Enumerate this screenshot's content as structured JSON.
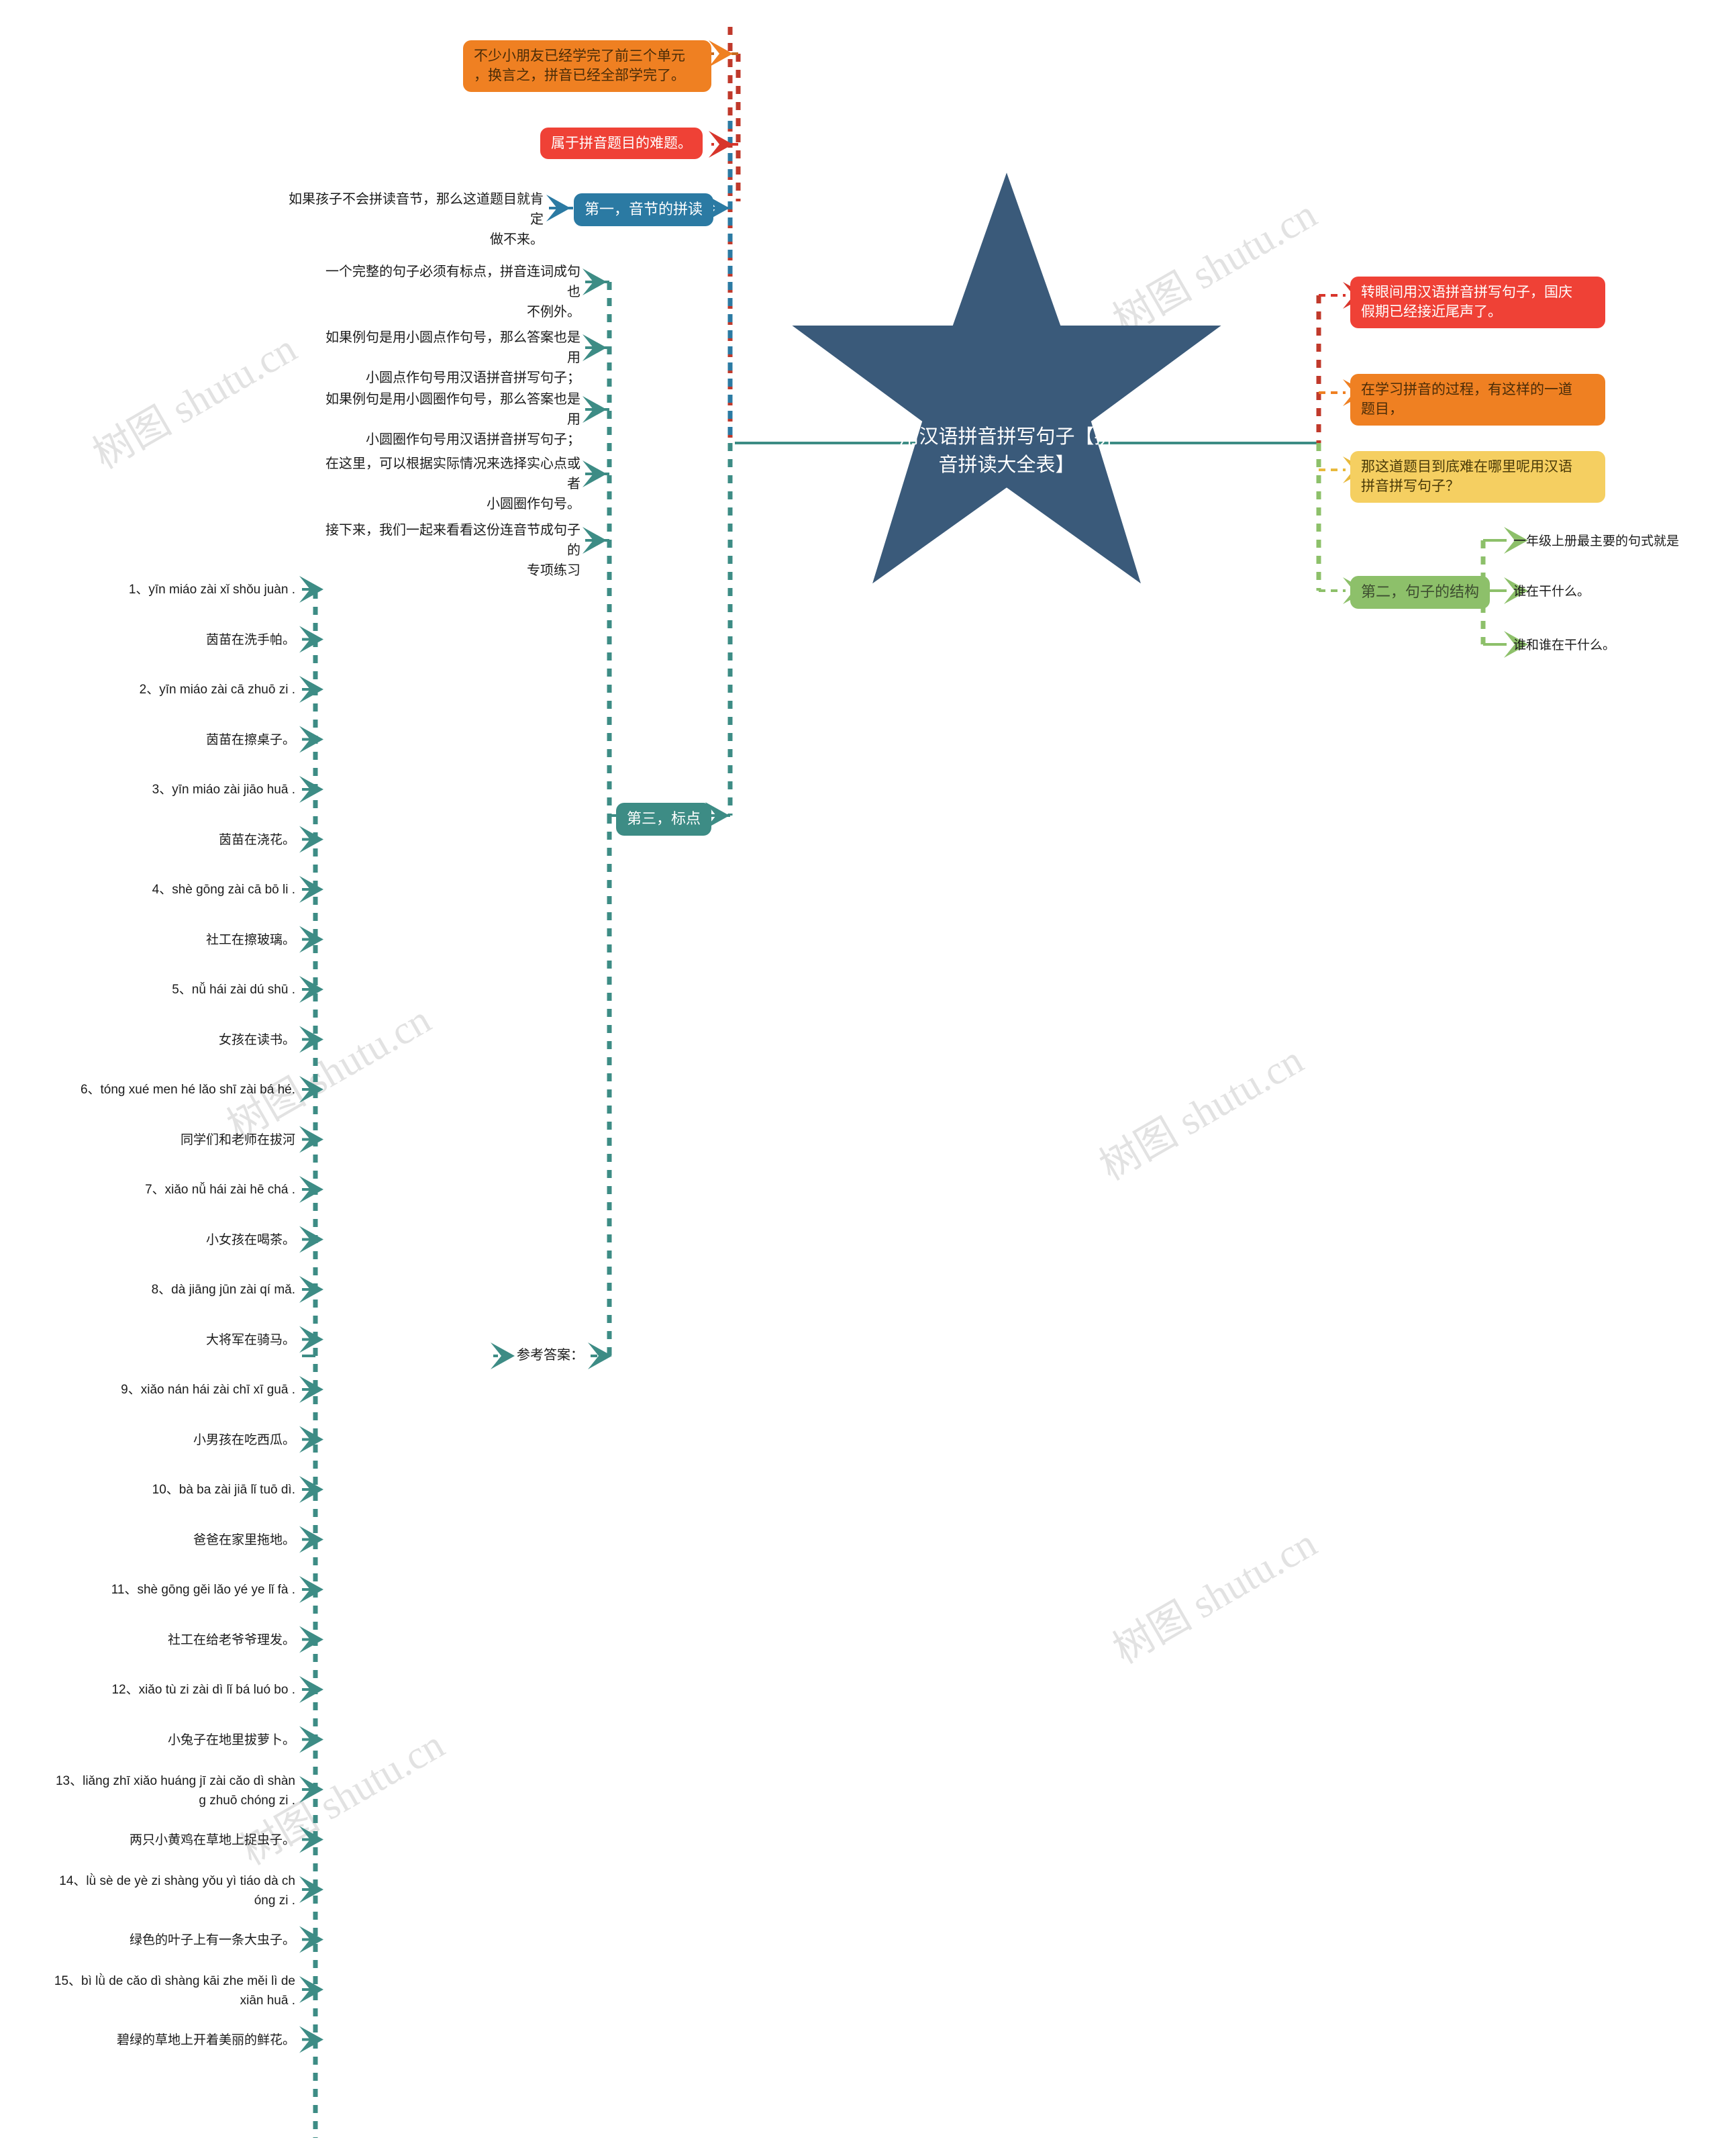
{
  "meta": {
    "watermark_text": "树图 shutu.cn",
    "canvas_bg": "#ffffff"
  },
  "colors": {
    "star": "#3a5a7a",
    "blue": "#2b7aa3",
    "teal": "#3d8c85",
    "green": "#8dc06a",
    "red": "#ef4136",
    "orange": "#ef8022",
    "yellow": "#f5cf61",
    "text_dark": "#1b1b1b"
  },
  "center": {
    "title_line1": "用汉语拼音拼写句子【拼",
    "title_line2": "音拼读大全表】",
    "shape": "five-point-star"
  },
  "right_branches": [
    {
      "label": "转眼间用汉语拼音拼写句子，国庆\n假期已经接近尾声了。",
      "style": "red"
    },
    {
      "label": "在学习拼音的过程，有这样的一道\n题目，",
      "style": "orange"
    },
    {
      "label": "那这道题目到底难在哪里呢用汉语\n拼音拼写句子？",
      "style": "yellow"
    },
    {
      "label": "第二，句子的结构",
      "style": "green"
    }
  ],
  "right_subitems": [
    {
      "label": "一年级上册最主要的句式就是"
    },
    {
      "label": "谁在干什么。"
    },
    {
      "label": "谁和谁在干什么。"
    }
  ],
  "branch_one": {
    "label": "第一，音节的拼读",
    "style": "blue",
    "children": [
      {
        "label": "不少小朋友已经学完了前三个单元\n，换言之，拼音已经全部学完了。",
        "style": "orange"
      },
      {
        "label": "属于拼音题目的难题。",
        "style": "red"
      },
      {
        "label": "如果孩子不会拼读音节，那么这道题目就肯定\n做不来。",
        "style": "plain"
      }
    ]
  },
  "branch_three": {
    "label": "第三，标点",
    "style": "teal",
    "children": [
      {
        "label": "一个完整的句子必须有标点，拼音连词成句也\n不例外。"
      },
      {
        "label": "如果例句是用小圆点作句号，那么答案也是用\n小圆点作句号用汉语拼音拼写句子；"
      },
      {
        "label": "如果例句是用小圆圈作句号，那么答案也是用\n小圆圈作句号用汉语拼音拼写句子；"
      },
      {
        "label": "在这里，可以根据实际情况来选择实心点或者\n小圆圈作句号。"
      },
      {
        "label": "接下来，我们一起来看看这份连音节成句子的\n专项练习"
      }
    ]
  },
  "answers_node": {
    "label": "参考答案："
  },
  "answers_list": [
    {
      "label": "1、yīn miáo zài xǐ shǒu juàn ."
    },
    {
      "label": "茵苗在洗手帕。"
    },
    {
      "label": "2、yīn miáo zài cā zhuō zi ."
    },
    {
      "label": "茵苗在擦桌子。"
    },
    {
      "label": "3、yīn miáo zài jiāo huā ."
    },
    {
      "label": "茵苗在浇花。"
    },
    {
      "label": "4、shè gōng zài cā bō li ."
    },
    {
      "label": "社工在擦玻璃。"
    },
    {
      "label": "5、nǚ hái zài dú shū ."
    },
    {
      "label": "女孩在读书。"
    },
    {
      "label": "6、tóng xué men hé lǎo shī zài bá hé."
    },
    {
      "label": "同学们和老师在拔河"
    },
    {
      "label": "7、xiǎo nǚ hái zài hē chá ."
    },
    {
      "label": "小女孩在喝茶。"
    },
    {
      "label": "8、dà jiāng jūn zài qí mǎ."
    },
    {
      "label": "大将军在骑马。"
    },
    {
      "label": "9、xiǎo nán hái zài chī xī guā ."
    },
    {
      "label": "小男孩在吃西瓜。"
    },
    {
      "label": "10、bà ba zài jiā lǐ tuō dì."
    },
    {
      "label": "爸爸在家里拖地。"
    },
    {
      "label": "11、shè gōng gěi lǎo yé ye lǐ fà ."
    },
    {
      "label": "社工在给老爷爷理发。"
    },
    {
      "label": "12、xiǎo tù zi zài dì lǐ bá luó bo ."
    },
    {
      "label": "小兔子在地里拔萝卜。"
    },
    {
      "label": "13、liǎng zhī xiǎo huáng jī zài cǎo dì shàn\ng zhuō chóng zi ."
    },
    {
      "label": "两只小黄鸡在草地上捉虫子。"
    },
    {
      "label": "14、lǜ sè de yè zi shàng yǒu yì tiáo dà ch\nóng zi ."
    },
    {
      "label": "绿色的叶子上有一条大虫子。"
    },
    {
      "label": "15、bì lǜ de cǎo dì shàng kāi zhe měi lì de\nxiān huā ."
    },
    {
      "label": "碧绿的草地上开着美丽的鲜花。"
    }
  ]
}
